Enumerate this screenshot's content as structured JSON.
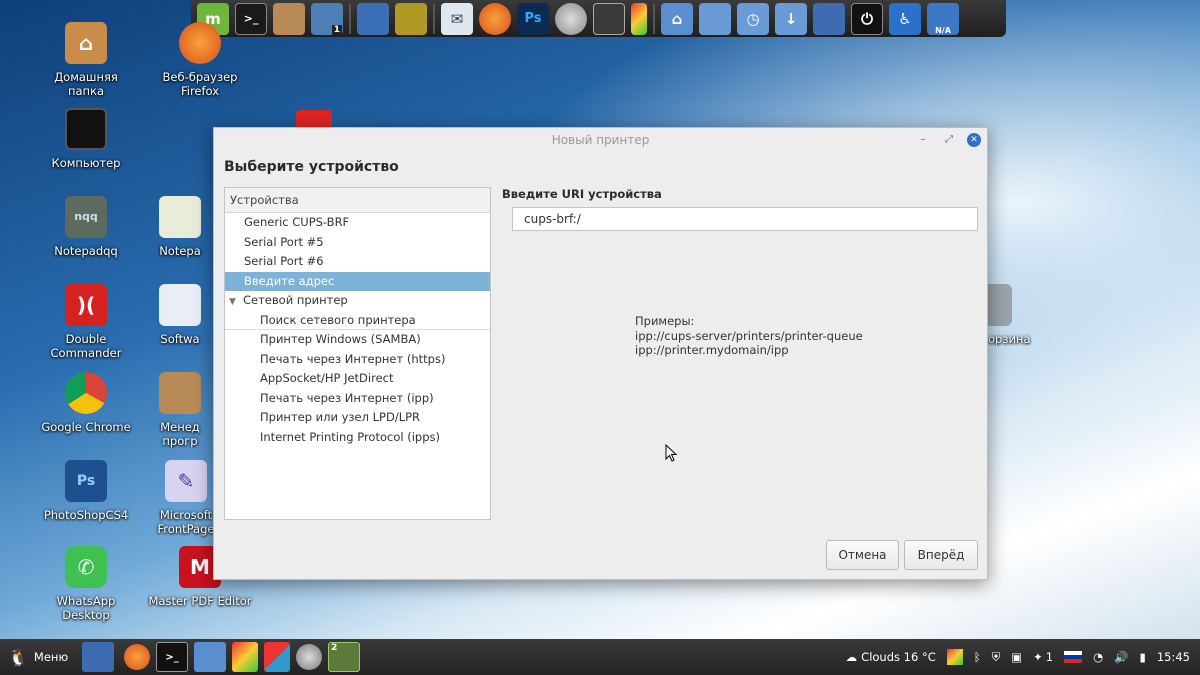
{
  "dock": {
    "icons": [
      "mint-icon",
      "terminal-icon",
      "package-installer-icon",
      "workspace-switcher-icon",
      "writer-icon",
      "wallpaper-icon",
      "mail-icon",
      "firefox-icon",
      "photoshop-icon",
      "media-player-icon",
      "screenshot-icon",
      "multicolor-app-icon",
      "home-folder-icon",
      "documents-folder-icon",
      "recent-folder-icon",
      "downloads-folder-icon",
      "desktop-show-icon",
      "power-icon",
      "accessibility-icon",
      "network-icon"
    ],
    "workspace_badge": "1",
    "network_label": "N/A"
  },
  "desktop": {
    "icons": [
      {
        "label": "Домашняя папка",
        "icon": "home-folder-icon"
      },
      {
        "label": "Веб-браузер Firefox",
        "icon": "firefox-icon"
      },
      {
        "label": "Компьютер",
        "icon": "computer-icon"
      },
      {
        "label": "Notepadqq",
        "icon": "notepadqq-icon"
      },
      {
        "label": "Notepa",
        "icon": "notepad-icon"
      },
      {
        "label": "Double Commander",
        "icon": "double-commander-icon"
      },
      {
        "label": "Softwa",
        "icon": "software-manager-icon"
      },
      {
        "label": "Google Chrome",
        "icon": "chrome-icon"
      },
      {
        "label": "Менед прогр",
        "icon": "package-manager-icon"
      },
      {
        "label": "PhotoShopCS4",
        "icon": "photoshop-icon"
      },
      {
        "label": "Microsoft FrontPage",
        "icon": "frontpage-icon"
      },
      {
        "label": "WhatsApp Desktop",
        "icon": "whatsapp-icon"
      },
      {
        "label": "Master PDF Editor",
        "icon": "pdf-editor-icon"
      },
      {
        "label": "орзина",
        "icon": "trash-icon"
      }
    ]
  },
  "dialog": {
    "title": "Новый принтер",
    "heading": "Выберите устройство",
    "devices_header": "Устройства",
    "devices": [
      {
        "label": "Generic CUPS-BRF",
        "kind": "item"
      },
      {
        "label": "Serial Port #5",
        "kind": "item"
      },
      {
        "label": "Serial Port #6",
        "kind": "item"
      },
      {
        "label": "Введите адрес",
        "kind": "selected"
      },
      {
        "label": "Сетевой принтер",
        "kind": "group"
      },
      {
        "label": "Поиск сетевого принтера",
        "kind": "child-divider"
      },
      {
        "label": "Принтер Windows (SAMBA)",
        "kind": "child"
      },
      {
        "label": "Печать через Интернет (https)",
        "kind": "child"
      },
      {
        "label": "AppSocket/HP JetDirect",
        "kind": "child"
      },
      {
        "label": "Печать через Интернет (ipp)",
        "kind": "child"
      },
      {
        "label": "Принтер или узел LPD/LPR",
        "kind": "child"
      },
      {
        "label": "Internet Printing Protocol (ipps)",
        "kind": "child"
      }
    ],
    "uri_label": "Введите URI устройства",
    "uri_value": "cups-brf:/",
    "examples": [
      "Примеры:",
      "ipp://cups-server/printers/printer-queue",
      "ipp://printer.mydomain/ipp"
    ],
    "cancel_label": "Отмена",
    "next_label": "Вперёд"
  },
  "panel": {
    "menu_label": "Меню",
    "weather": "Clouds 16 °C",
    "notifications_count": "1",
    "time": "15:45",
    "workspace_badge": "2"
  },
  "colors": {
    "selection": "#7fb2d8",
    "close_button": "#2e6fd0",
    "panel": "#2b2b2b"
  }
}
